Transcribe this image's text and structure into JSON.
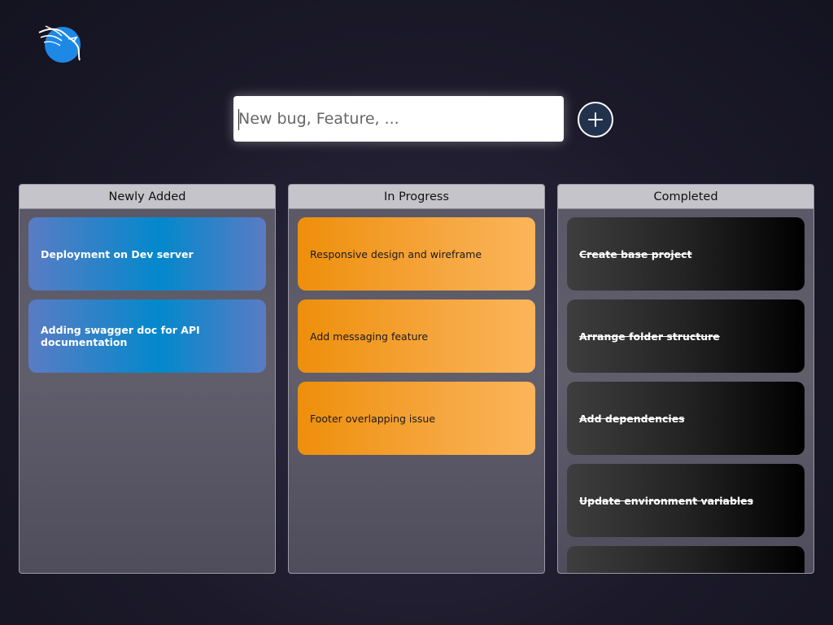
{
  "logo": {
    "icon": "dragon-logo-icon",
    "color": "#1e88e5"
  },
  "new_item": {
    "placeholder": "New bug, Feature, ...",
    "value": "",
    "add_icon": "plus-icon"
  },
  "columns": [
    {
      "title": "Newly Added",
      "items": [
        "Deployment on Dev server",
        "Adding swagger doc for API documentation"
      ]
    },
    {
      "title": "In Progress",
      "items": [
        "Responsive design and wireframe",
        "Add messaging feature",
        "Footer overlapping issue"
      ]
    },
    {
      "title": "Completed",
      "items": [
        "Create base project",
        "Arrange folder structure",
        "Add dependencies",
        "Update environment variables",
        ""
      ]
    }
  ],
  "colors": {
    "newly_added": "#0388cc",
    "in_progress": "#f6a63e",
    "completed": "#000000",
    "add_button": "#22324c"
  }
}
